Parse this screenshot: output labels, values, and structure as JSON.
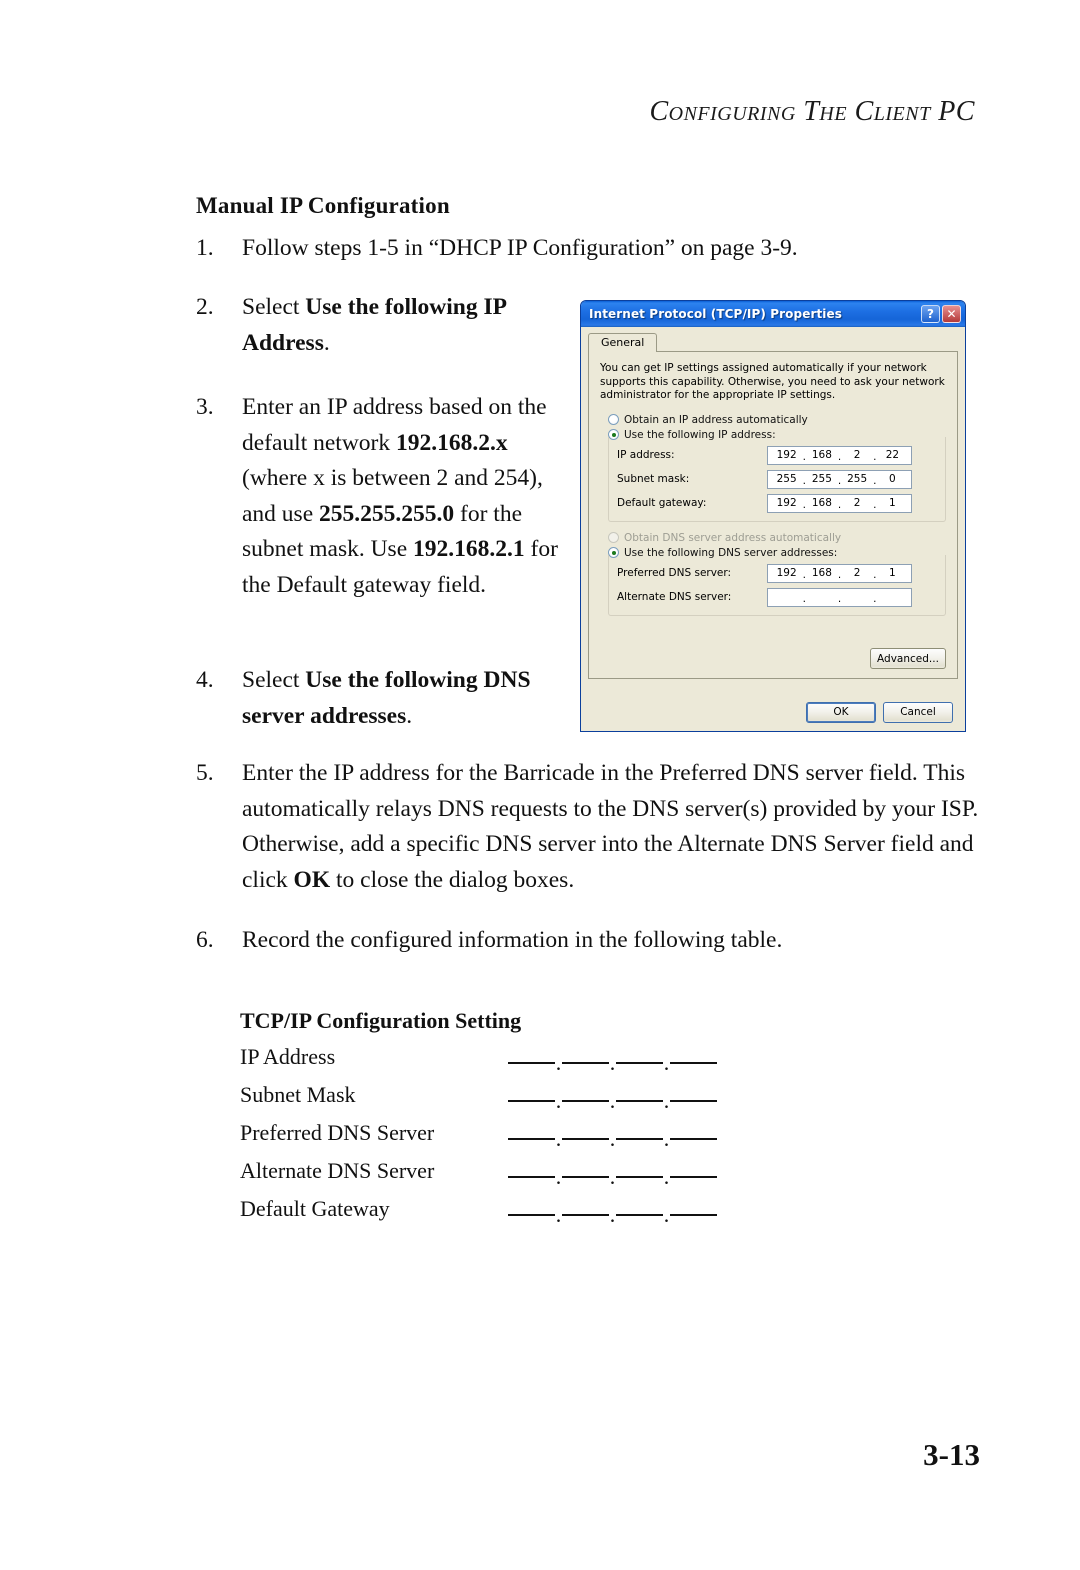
{
  "header": {
    "running_head": "Configuring The Client PC"
  },
  "section": {
    "heading": "Manual IP Configuration"
  },
  "steps": [
    {
      "num": "1.",
      "text": "Follow steps 1-5 in “DHCP IP Configuration” on page 3-9."
    },
    {
      "num": "2.",
      "prefix": "Select ",
      "bold": "Use the following IP Address",
      "suffix": "."
    },
    {
      "num": "3.",
      "p1": "Enter an IP address based on the default network ",
      "b1": "192.168.2.x",
      "p2": " (where x is between 2 and 254), and use ",
      "b2": "255.255.255.0",
      "p3": " for the subnet mask. Use ",
      "b3": "192.168.2.1",
      "p4": " for the Default gateway field."
    },
    {
      "num": "4.",
      "prefix": "Select ",
      "bold": "Use the following DNS server addresses",
      "suffix": "."
    },
    {
      "num": "5.",
      "p1": "Enter the IP address for the Barricade in the Preferred DNS server field. This automatically relays DNS requests to the DNS server(s) provided by your ISP. Otherwise, add a specific DNS server into the Alternate DNS Server field and click ",
      "b1": "OK",
      "p2": " to close the dialog boxes."
    },
    {
      "num": "6.",
      "text": "Record the configured information in the following table."
    }
  ],
  "tcpip_table": {
    "title": "TCP/IP Configuration Setting",
    "separator": ".",
    "rows": [
      {
        "label": "IP Address"
      },
      {
        "label": "Subnet Mask"
      },
      {
        "label": "Preferred DNS Server"
      },
      {
        "label": "Alternate DNS Server"
      },
      {
        "label": "Default Gateway"
      }
    ]
  },
  "page_number": "3-13",
  "dialog": {
    "title": "Internet Protocol (TCP/IP) Properties",
    "help_button": "?",
    "close_button": "✕",
    "tab": "General",
    "intro": "You can get IP settings assigned automatically if your network supports this capability. Otherwise, you need to ask your network administrator for the appropriate IP settings.",
    "ip_auto_radio": "Obtain an IP address automatically",
    "ip_manual_radio": "Use the following IP address:",
    "dns_auto_radio": "Obtain DNS server address automatically",
    "dns_manual_radio": "Use the following DNS server addresses:",
    "fields": [
      {
        "label": "IP address:",
        "octets": [
          "192",
          "168",
          "2",
          "22"
        ]
      },
      {
        "label": "Subnet mask:",
        "octets": [
          "255",
          "255",
          "255",
          "0"
        ]
      },
      {
        "label": "Default gateway:",
        "octets": [
          "192",
          "168",
          "2",
          "1"
        ]
      },
      {
        "label": "Preferred DNS server:",
        "octets": [
          "192",
          "168",
          "2",
          "1"
        ]
      },
      {
        "label": "Alternate DNS server:",
        "octets": [
          "",
          "",
          "",
          ""
        ]
      }
    ],
    "advanced_button": "Advanced...",
    "ok_button": "OK",
    "cancel_button": "Cancel",
    "octet_separator": ".",
    "colors": {
      "titlebar_blue": "#1565d8",
      "dialog_face": "#ece9d8",
      "close_red": "#b33a3a",
      "radio_dot_green": "#1d7a1d"
    }
  }
}
